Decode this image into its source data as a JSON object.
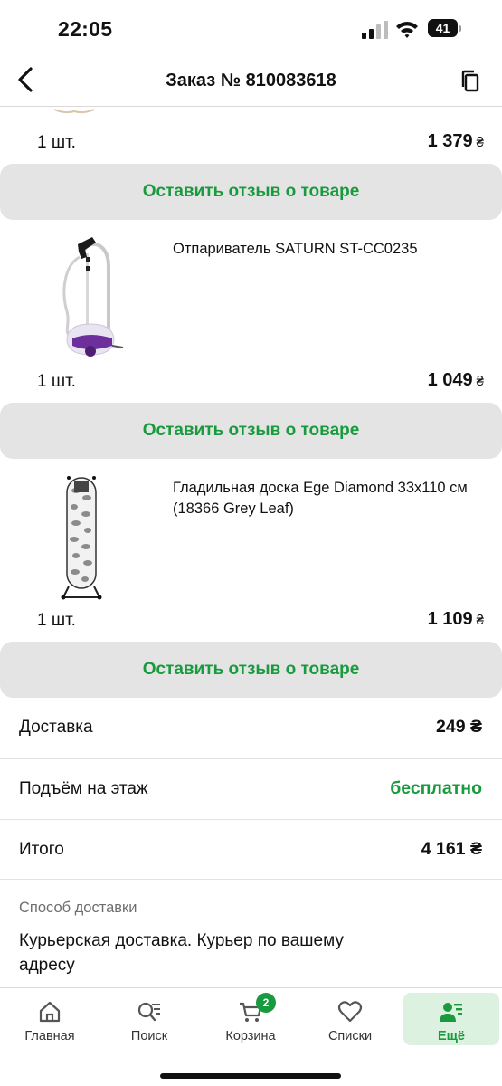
{
  "status_bar": {
    "time": "22:05",
    "battery": "41"
  },
  "header": {
    "title": "Заказ № 810083618"
  },
  "items": [
    {
      "name": "",
      "quantity": "1 шт.",
      "price": "1 379",
      "currency": "₴",
      "review_label": "Оставить отзыв о товаре"
    },
    {
      "name": "Отпариватель SATURN ST-CC0235",
      "quantity": "1 шт.",
      "price": "1 049",
      "currency": "₴",
      "review_label": "Оставить отзыв о товаре"
    },
    {
      "name": "Гладильная доска Ege Diamond 33х110 см (18366 Grey Leaf)",
      "quantity": "1 шт.",
      "price": "1 109",
      "currency": "₴",
      "review_label": "Оставить отзыв о товаре"
    }
  ],
  "summary": {
    "delivery_label": "Доставка",
    "delivery_value": "249 ₴",
    "lift_label": "Подъём на этаж",
    "lift_value": "бесплатно",
    "total_label": "Итого",
    "total_value": "4 161 ₴"
  },
  "delivery_method": {
    "caption": "Способ доставки",
    "text": "Курьерская доставка. Курьер по вашему адресу"
  },
  "tab_bar": {
    "tabs": [
      {
        "label": "Главная",
        "icon": "home-icon"
      },
      {
        "label": "Поиск",
        "icon": "search-icon"
      },
      {
        "label": "Корзина",
        "icon": "cart-icon",
        "badge": "2"
      },
      {
        "label": "Списки",
        "icon": "heart-icon"
      },
      {
        "label": "Ещё",
        "icon": "profile-menu-icon",
        "active": true
      }
    ]
  },
  "colors": {
    "accent": "#1a9a3e",
    "button_bg": "#e4e4e4",
    "active_tab_bg": "#dcf1df"
  }
}
